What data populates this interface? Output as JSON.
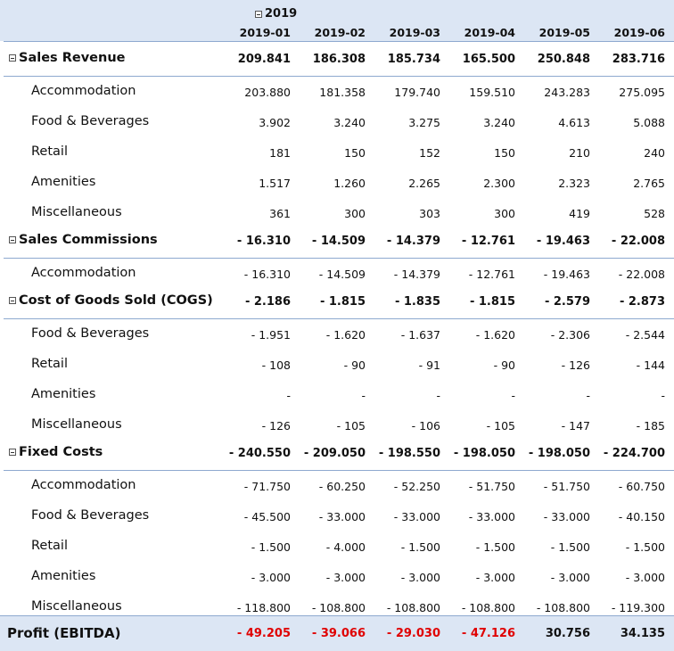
{
  "header": {
    "year": "2019",
    "months": [
      "2019-01",
      "2019-02",
      "2019-03",
      "2019-04",
      "2019-05",
      "2019-06"
    ]
  },
  "rows": [
    {
      "label": "Sales Revenue",
      "group": true,
      "values": [
        "209.841",
        "186.308",
        "185.734",
        "165.500",
        "250.848",
        "283.716"
      ]
    },
    {
      "label": "Accommodation",
      "group": false,
      "values": [
        "203.880",
        "181.358",
        "179.740",
        "159.510",
        "243.283",
        "275.095"
      ]
    },
    {
      "label": "Food & Beverages",
      "group": false,
      "values": [
        "3.902",
        "3.240",
        "3.275",
        "3.240",
        "4.613",
        "5.088"
      ]
    },
    {
      "label": "Retail",
      "group": false,
      "values": [
        "181",
        "150",
        "152",
        "150",
        "210",
        "240"
      ]
    },
    {
      "label": "Amenities",
      "group": false,
      "values": [
        "1.517",
        "1.260",
        "2.265",
        "2.300",
        "2.323",
        "2.765"
      ]
    },
    {
      "label": "Miscellaneous",
      "group": false,
      "values": [
        "361",
        "300",
        "303",
        "300",
        "419",
        "528"
      ]
    },
    {
      "label": "Sales Commissions",
      "group": true,
      "values": [
        "- 16.310",
        "- 14.509",
        "- 14.379",
        "- 12.761",
        "- 19.463",
        "- 22.008"
      ]
    },
    {
      "label": "Accommodation",
      "group": false,
      "values": [
        "- 16.310",
        "- 14.509",
        "- 14.379",
        "- 12.761",
        "- 19.463",
        "- 22.008"
      ]
    },
    {
      "label": "Cost of Goods Sold (COGS)",
      "group": true,
      "values": [
        "- 2.186",
        "- 1.815",
        "- 1.835",
        "- 1.815",
        "- 2.579",
        "- 2.873"
      ]
    },
    {
      "label": "Food & Beverages",
      "group": false,
      "values": [
        "- 1.951",
        "- 1.620",
        "- 1.637",
        "- 1.620",
        "- 2.306",
        "- 2.544"
      ]
    },
    {
      "label": "Retail",
      "group": false,
      "values": [
        "- 108",
        "- 90",
        "- 91",
        "- 90",
        "- 126",
        "- 144"
      ]
    },
    {
      "label": "Amenities",
      "group": false,
      "values": [
        "-",
        "-",
        "-",
        "-",
        "-",
        "-"
      ]
    },
    {
      "label": "Miscellaneous",
      "group": false,
      "values": [
        "- 126",
        "- 105",
        "- 106",
        "- 105",
        "- 147",
        "- 185"
      ]
    },
    {
      "label": "Fixed Costs",
      "group": true,
      "values": [
        "- 240.550",
        "- 209.050",
        "- 198.550",
        "- 198.050",
        "- 198.050",
        "- 224.700"
      ]
    },
    {
      "label": "Accommodation",
      "group": false,
      "values": [
        "- 71.750",
        "- 60.250",
        "- 52.250",
        "- 51.750",
        "- 51.750",
        "- 60.750"
      ]
    },
    {
      "label": "Food & Beverages",
      "group": false,
      "values": [
        "- 45.500",
        "- 33.000",
        "- 33.000",
        "- 33.000",
        "- 33.000",
        "- 40.150"
      ]
    },
    {
      "label": "Retail",
      "group": false,
      "values": [
        "- 1.500",
        "- 4.000",
        "- 1.500",
        "- 1.500",
        "- 1.500",
        "- 1.500"
      ]
    },
    {
      "label": "Amenities",
      "group": false,
      "values": [
        "- 3.000",
        "- 3.000",
        "- 3.000",
        "- 3.000",
        "- 3.000",
        "- 3.000"
      ]
    },
    {
      "label": "Miscellaneous",
      "group": false,
      "values": [
        "- 118.800",
        "- 108.800",
        "- 108.800",
        "- 108.800",
        "- 108.800",
        "- 119.300"
      ]
    }
  ],
  "total": {
    "label": "Profit (EBITDA)",
    "values": [
      "- 49.205",
      "- 39.066",
      "- 29.030",
      "- 47.126",
      "30.756",
      "34.135"
    ]
  },
  "colors": {
    "negative_total": "#e00000",
    "header_band": "#dce6f4",
    "rule": "#8ea9cf"
  }
}
